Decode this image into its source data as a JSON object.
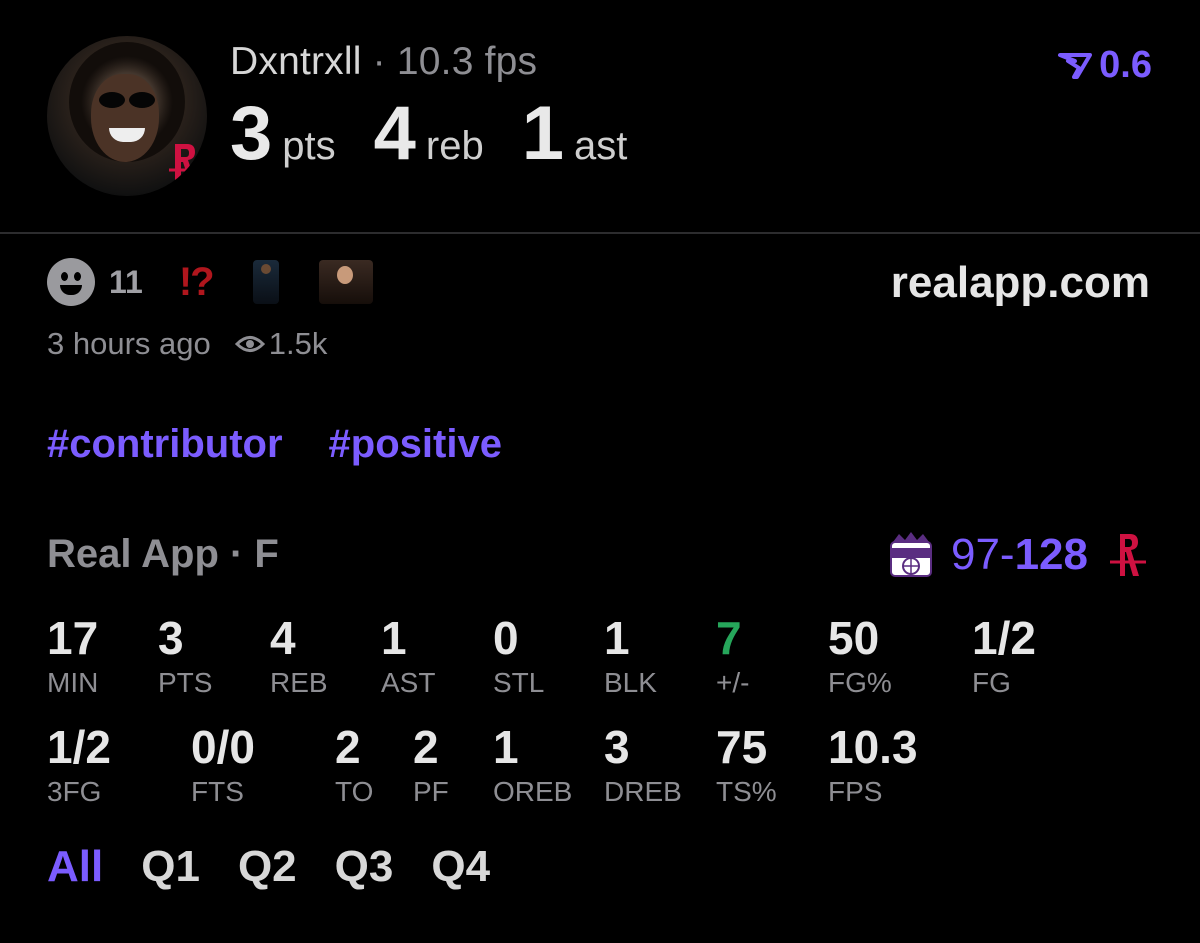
{
  "header": {
    "username": "Dxntrxll",
    "separator": "·",
    "fps_text": "10.3 fps",
    "statline": [
      {
        "value": "3",
        "unit": "pts"
      },
      {
        "value": "4",
        "unit": "reb"
      },
      {
        "value": "1",
        "unit": "ast"
      }
    ],
    "rating": "0.6"
  },
  "reactions": {
    "count": "11",
    "interrobang": "!?"
  },
  "site": "realapp.com",
  "meta": {
    "time_ago": "3 hours ago",
    "views": "1.5k"
  },
  "tags": [
    "#contributor",
    "#positive"
  ],
  "game": {
    "league": "Real App · F",
    "score_loser": "97",
    "score_dash": "-",
    "score_winner": "128"
  },
  "stats_row1": [
    {
      "value": "17",
      "label": "MIN"
    },
    {
      "value": "3",
      "label": "PTS"
    },
    {
      "value": "4",
      "label": "REB"
    },
    {
      "value": "1",
      "label": "AST"
    },
    {
      "value": "0",
      "label": "STL"
    },
    {
      "value": "1",
      "label": "BLK"
    },
    {
      "value": "7",
      "label": "+/-"
    },
    {
      "value": "50",
      "label": "FG%"
    },
    {
      "value": "1/2",
      "label": "FG"
    }
  ],
  "stats_row2": [
    {
      "value": "1/2",
      "label": "3FG"
    },
    {
      "value": "0/0",
      "label": "FTS"
    },
    {
      "value": "2",
      "label": "TO"
    },
    {
      "value": "2",
      "label": "PF"
    },
    {
      "value": "1",
      "label": "OREB"
    },
    {
      "value": "3",
      "label": "DREB"
    },
    {
      "value": "75",
      "label": "TS%"
    },
    {
      "value": "10.3",
      "label": "FPS"
    }
  ],
  "quarters": [
    "All",
    "Q1",
    "Q2",
    "Q3",
    "Q4"
  ],
  "colors": {
    "accent": "#7b5cff",
    "positive": "#26a65b",
    "rockets_red": "#ce1141",
    "muted": "#8e8e93"
  }
}
